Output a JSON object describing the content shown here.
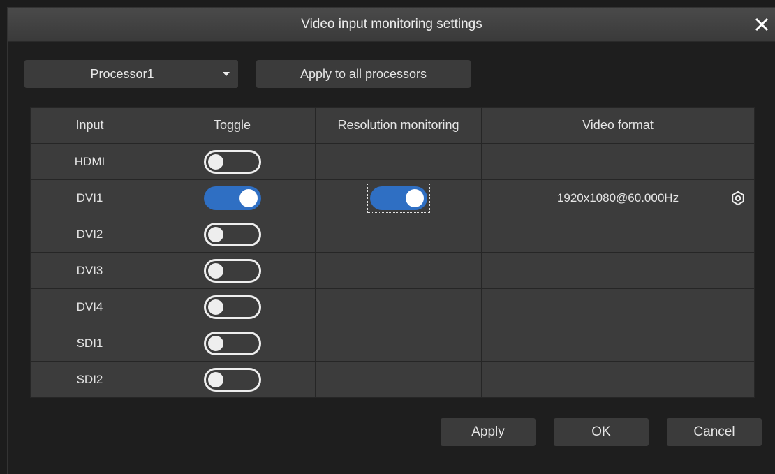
{
  "window": {
    "title": "Video input monitoring settings"
  },
  "toolbar": {
    "processor_value": "Processor1",
    "apply_all_label": "Apply to all processors"
  },
  "table": {
    "headers": [
      "Input",
      "Toggle",
      "Resolution monitoring",
      "Video format"
    ],
    "rows": [
      {
        "input": "HDMI",
        "toggle": false,
        "resolution_monitoring": null,
        "video_format": ""
      },
      {
        "input": "DVI1",
        "toggle": true,
        "resolution_monitoring": true,
        "video_format": "1920x1080@60.000Hz"
      },
      {
        "input": "DVI2",
        "toggle": false,
        "resolution_monitoring": null,
        "video_format": ""
      },
      {
        "input": "DVI3",
        "toggle": false,
        "resolution_monitoring": null,
        "video_format": ""
      },
      {
        "input": "DVI4",
        "toggle": false,
        "resolution_monitoring": null,
        "video_format": ""
      },
      {
        "input": "SDI1",
        "toggle": false,
        "resolution_monitoring": null,
        "video_format": ""
      },
      {
        "input": "SDI2",
        "toggle": false,
        "resolution_monitoring": null,
        "video_format": ""
      }
    ]
  },
  "footer": {
    "apply_label": "Apply",
    "ok_label": "OK",
    "cancel_label": "Cancel"
  },
  "colors": {
    "toggle_on": "#2f6fc3",
    "cell_background": "#3c3c3c",
    "window_background": "#1e1e1e"
  },
  "icons": {
    "close": "close-icon",
    "dropdown": "chevron-down-icon",
    "settings": "gear-icon"
  }
}
